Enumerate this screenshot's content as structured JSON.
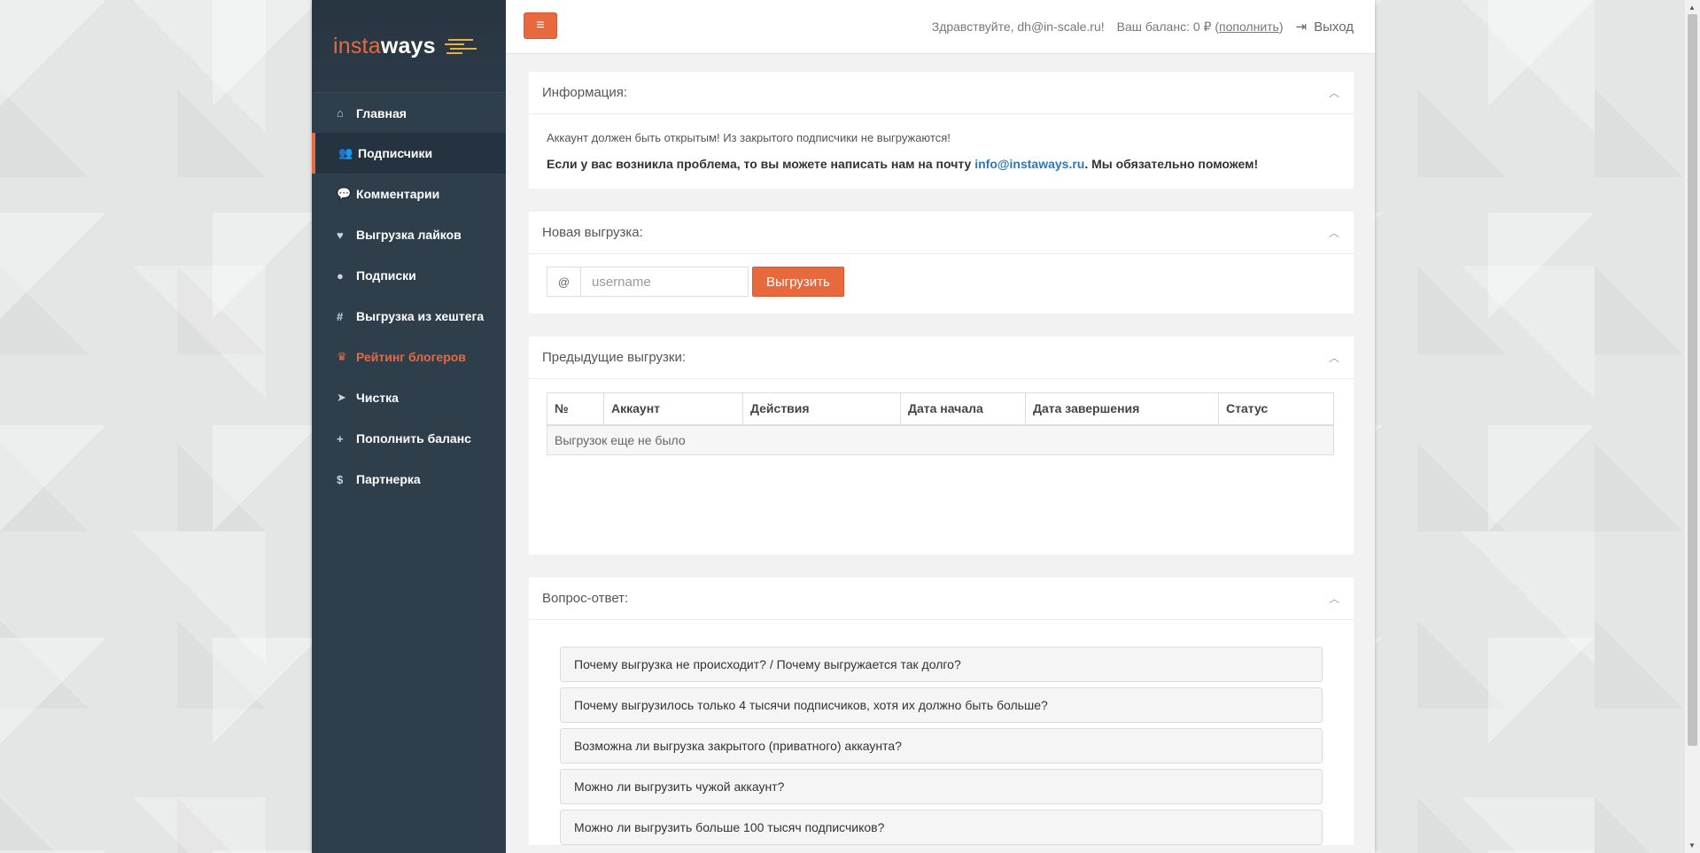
{
  "brand": {
    "insta": "insta",
    "ways": "ways",
    "accent": "#e8693e",
    "sidebar_bg": "#2f3e4b"
  },
  "sidebar": {
    "items": [
      {
        "label": "Главная",
        "icon": "home-icon",
        "glyph": "⌂"
      },
      {
        "label": "Подписчики",
        "icon": "users-icon",
        "glyph": "👥"
      },
      {
        "label": "Комментарии",
        "icon": "comments-icon",
        "glyph": "💬"
      },
      {
        "label": "Выгрузка лайков",
        "icon": "heart-icon",
        "glyph": "♥"
      },
      {
        "label": "Подписки",
        "icon": "user-circle-icon",
        "glyph": "●"
      },
      {
        "label": "Выгрузка из хештега",
        "icon": "hashtag-icon",
        "glyph": "#"
      },
      {
        "label": "Рейтинг блогеров",
        "icon": "crown-icon",
        "glyph": "♛"
      },
      {
        "label": "Чистка",
        "icon": "rocket-icon",
        "glyph": "➤"
      },
      {
        "label": "Пополнить баланс",
        "icon": "plus-icon",
        "glyph": "+"
      },
      {
        "label": "Партнерка",
        "icon": "dollar-icon",
        "glyph": "$"
      }
    ],
    "active_index": 1,
    "highlight_index": 6
  },
  "header": {
    "menu_glyph": "≡",
    "greeting": "Здравствуйте, dh@in-scale.ru!",
    "balance_prefix": "Ваш баланс: 0 ₽ (",
    "topup_link": "пополнить",
    "balance_suffix": ")",
    "logout_label": "Выход",
    "logout_glyph": "⇥"
  },
  "info_panel": {
    "title": "Информация:",
    "line1": "Аккаунт должен быть открытым! Из закрытого подписчики не выгружаются!",
    "line2_prefix": "Если у вас возникла проблема, то вы можете написать нам на почту ",
    "line2_email": "info@instaways.ru",
    "line2_suffix": ". Мы обязательно поможем!"
  },
  "new_upload": {
    "title": "Новая выгрузка:",
    "at_sign": "@",
    "placeholder": "username",
    "value": "",
    "button_label": "Выгрузить"
  },
  "previous": {
    "title": "Предыдущие выгрузки:",
    "columns": [
      "№",
      "Аккаунт",
      "Действия",
      "Дата начала",
      "Дата завершения",
      "Статус"
    ],
    "empty_text": "Выгрузок еще не было"
  },
  "faq": {
    "title": "Вопрос-ответ:",
    "items": [
      "Почему выгрузка не происходит? / Почему выгружается так долго?",
      "Почему выгрузилось только 4 тысячи подписчиков, хотя их должно быть больше?",
      "Возможна ли выгрузка закрытого (приватного) аккаунта?",
      "Можно ли выгрузить чужой аккаунт?",
      "Можно ли выгрузить больше 100 тысяч подписчиков?"
    ]
  },
  "chevron_glyph": "︿"
}
